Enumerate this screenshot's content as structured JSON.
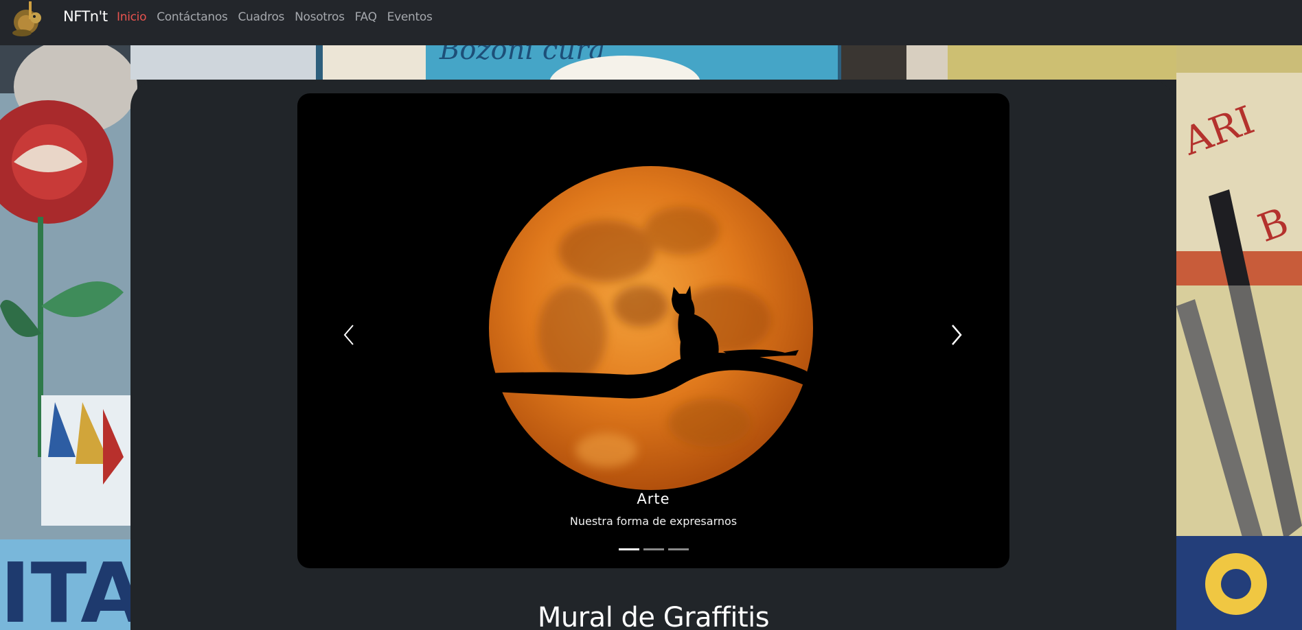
{
  "brand": "NFTn't",
  "nav": [
    {
      "label": "Inicio",
      "active": true
    },
    {
      "label": "Contáctanos",
      "active": false
    },
    {
      "label": "Cuadros",
      "active": false
    },
    {
      "label": "Nosotros",
      "active": false
    },
    {
      "label": "FAQ",
      "active": false
    },
    {
      "label": "Eventos",
      "active": false
    }
  ],
  "carousel": {
    "caption_title": "Arte",
    "caption_text": "Nuestra forma de expresarnos",
    "slide_count": 3,
    "active_slide": 1,
    "prev_icon": "chevron-left-icon",
    "next_icon": "chevron-right-icon"
  },
  "section_title": "Mural de Graffitis",
  "colors": {
    "nav_bg": "#23262b",
    "panel_bg": "#212529",
    "active_link": "#e8534f",
    "link": "#a5a8ad"
  }
}
